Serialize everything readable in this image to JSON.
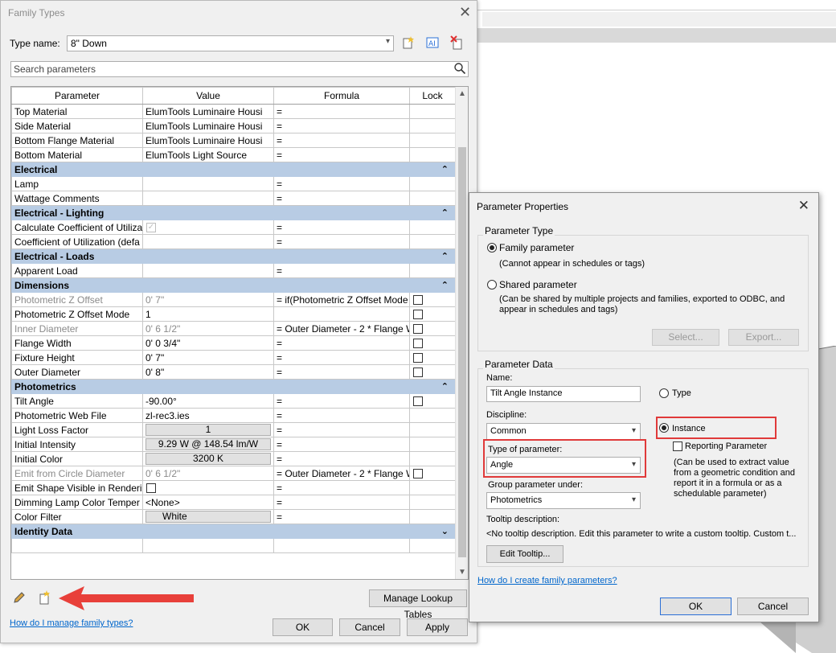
{
  "family_types": {
    "title": "Family Types",
    "type_name_label": "Type name:",
    "type_name_value": "8\" Down",
    "search_placeholder": "Search parameters",
    "columns": [
      "Parameter",
      "Value",
      "Formula",
      "Lock"
    ],
    "rows": [
      {
        "kind": "row",
        "param": "Top Material",
        "value": "ElumTools Luminaire Housi",
        "formula": "="
      },
      {
        "kind": "row",
        "param": "Side Material",
        "value": "ElumTools Luminaire Housi",
        "formula": "="
      },
      {
        "kind": "row",
        "param": "Bottom Flange Material",
        "value": "ElumTools Luminaire Housi",
        "formula": "="
      },
      {
        "kind": "row",
        "param": "Bottom Material",
        "value": "ElumTools Light Source",
        "formula": "="
      },
      {
        "kind": "group",
        "param": "Electrical"
      },
      {
        "kind": "row",
        "param": "Lamp",
        "value": "",
        "formula": "="
      },
      {
        "kind": "row",
        "param": "Wattage Comments",
        "value": "",
        "formula": "="
      },
      {
        "kind": "group",
        "param": "Electrical - Lighting"
      },
      {
        "kind": "row",
        "param": "Calculate Coefficient of Utiliza",
        "value": "",
        "value_check": "disabled",
        "formula": "="
      },
      {
        "kind": "row",
        "param": "Coefficient of Utilization (defa",
        "value": "",
        "formula": "="
      },
      {
        "kind": "group",
        "param": "Electrical - Loads"
      },
      {
        "kind": "row",
        "param": "Apparent Load",
        "value": "",
        "formula": "="
      },
      {
        "kind": "group",
        "param": "Dimensions"
      },
      {
        "kind": "row",
        "param": "Photometric Z Offset",
        "value": "0'  7\"",
        "formula": "= if(Photometric Z Offset Mode",
        "lock": true,
        "gray": true
      },
      {
        "kind": "row",
        "param": "Photometric Z Offset Mode",
        "value": "1",
        "formula": "",
        "lock": true
      },
      {
        "kind": "row",
        "param": "Inner Diameter",
        "value": "0'  6 1/2\"",
        "formula": "= Outer Diameter - 2 * Flange W",
        "lock": true,
        "gray": true
      },
      {
        "kind": "row",
        "param": "Flange Width",
        "value": "0'  0 3/4\"",
        "formula": "=",
        "lock": true
      },
      {
        "kind": "row",
        "param": "Fixture Height",
        "value": "0'  7\"",
        "formula": "=",
        "lock": true
      },
      {
        "kind": "row",
        "param": "Outer Diameter",
        "value": "0'  8\"",
        "formula": "=",
        "lock": true
      },
      {
        "kind": "group",
        "param": "Photometrics"
      },
      {
        "kind": "row",
        "param": "Tilt Angle",
        "value": "-90.00°",
        "formula": "=",
        "lock": true
      },
      {
        "kind": "row",
        "param": "Photometric Web File",
        "value": "zl-rec3.ies",
        "formula": "="
      },
      {
        "kind": "row",
        "param": "Light Loss Factor",
        "value": "1",
        "value_button": true,
        "formula": "="
      },
      {
        "kind": "row",
        "param": "Initial Intensity",
        "value": "9.29 W @ 148.54 lm/W",
        "value_button": true,
        "formula": "="
      },
      {
        "kind": "row",
        "param": "Initial Color",
        "value": "3200 K",
        "value_button": true,
        "formula": "="
      },
      {
        "kind": "row",
        "param": "Emit from Circle Diameter",
        "value": "0'  6 1/2\"",
        "formula": "= Outer Diameter - 2 * Flange W",
        "lock": true,
        "gray": true
      },
      {
        "kind": "row",
        "param": "Emit Shape Visible in Renderin",
        "value": "",
        "value_check": "enabled",
        "formula": "="
      },
      {
        "kind": "row",
        "param": "Dimming Lamp Color Temper",
        "value": "<None>",
        "formula": "="
      },
      {
        "kind": "row",
        "param": "Color Filter",
        "value": "White",
        "value_button": true,
        "value_left": true,
        "formula": "="
      },
      {
        "kind": "group",
        "param": "Identity Data",
        "expand": true
      }
    ],
    "manage_lookup_label": "Manage Lookup Tables",
    "help_link": "How do I manage family types?",
    "ok_label": "OK",
    "cancel_label": "Cancel",
    "apply_label": "Apply"
  },
  "param_props": {
    "title": "Parameter Properties",
    "parameter_type_legend": "Parameter Type",
    "family_param_label": "Family parameter",
    "family_param_note": "(Cannot appear in schedules or tags)",
    "shared_param_label": "Shared parameter",
    "shared_param_note": "(Can be shared by multiple projects and families, exported to ODBC, and appear in schedules and tags)",
    "select_label": "Select...",
    "export_label": "Export...",
    "parameter_data_legend": "Parameter Data",
    "name_label": "Name:",
    "name_value": "Tilt Angle Instance",
    "type_label": "Type",
    "instance_label": "Instance",
    "reporting_label": "Reporting Parameter",
    "reporting_note": "(Can be used to extract value from a geometric condition and report it in a formula or as a schedulable parameter)",
    "discipline_label": "Discipline:",
    "discipline_value": "Common",
    "type_of_param_label": "Type of parameter:",
    "type_of_param_value": "Angle",
    "group_under_label": "Group parameter under:",
    "group_under_value": "Photometrics",
    "tooltip_label": "Tooltip description:",
    "tooltip_value": "<No tooltip description. Edit this parameter to write a custom tooltip. Custom t...",
    "edit_tooltip_label": "Edit Tooltip...",
    "help_link": "How do I create family parameters?",
    "ok_label": "OK",
    "cancel_label": "Cancel"
  },
  "colors": {
    "group_header": "#b8cce4",
    "highlight_red": "#e03a3a",
    "arrow_red": "#e8403a",
    "link": "#0066cc"
  },
  "icons": [
    "new-type-icon",
    "rename-type-icon",
    "delete-type-icon",
    "search-icon",
    "collapse-icon",
    "expand-icon",
    "pencil-icon",
    "new-parameter-icon",
    "close-icon",
    "chevron-down-icon"
  ]
}
